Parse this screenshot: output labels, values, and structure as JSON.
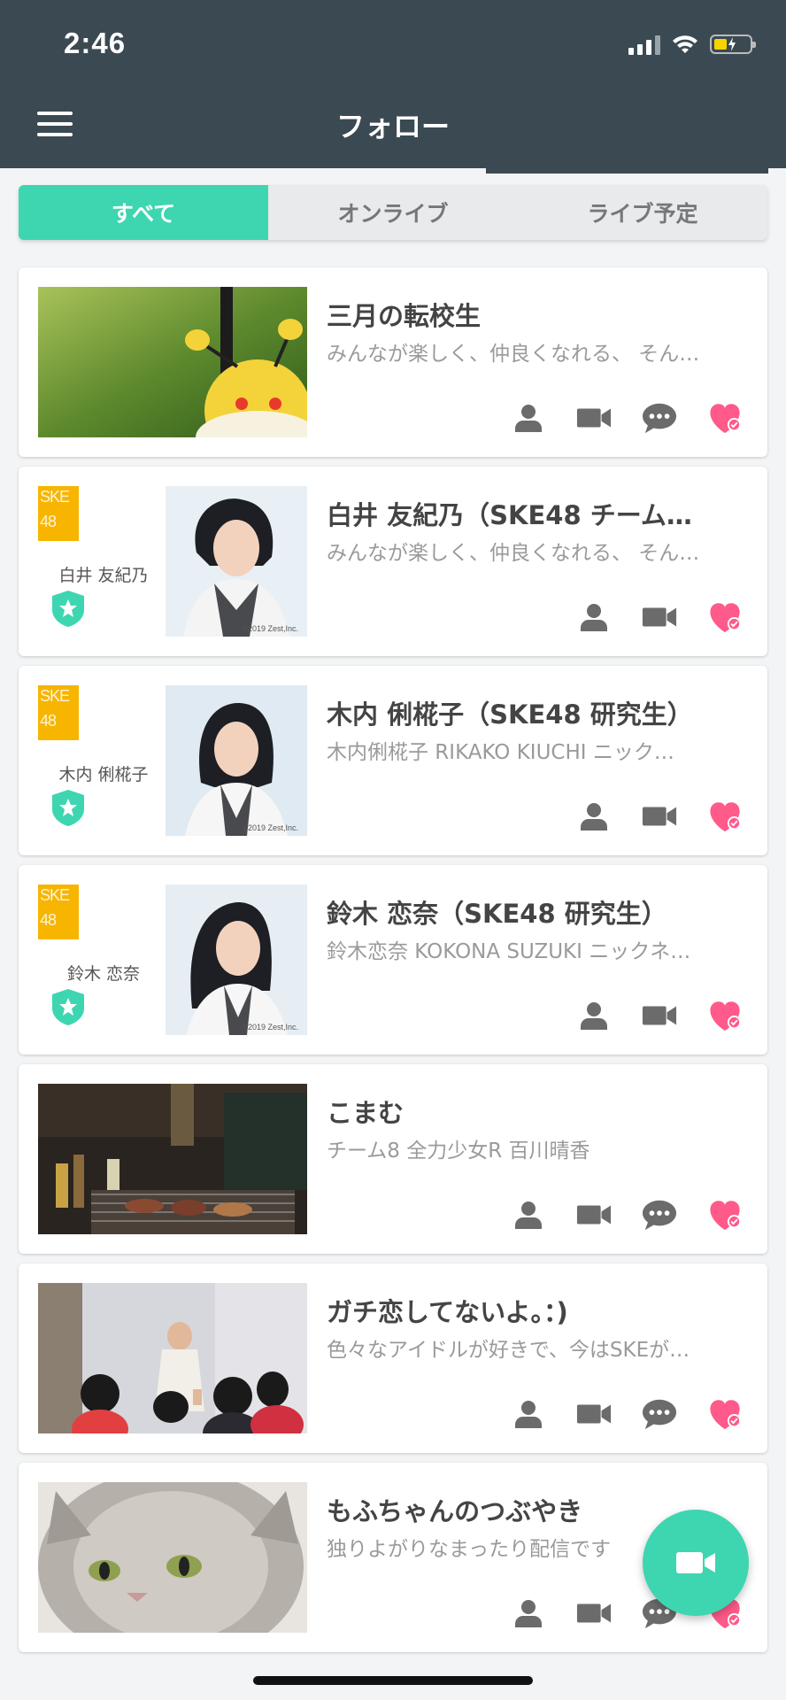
{
  "status_bar": {
    "time": "2:46"
  },
  "header": {
    "title": "フォロー",
    "menu_icon": "hamburger-menu-icon"
  },
  "tabs": [
    {
      "label": "すべて",
      "active": true
    },
    {
      "label": "オンライブ",
      "active": false
    },
    {
      "label": "ライブ予定",
      "active": false
    }
  ],
  "cards": [
    {
      "title": "三月の転校生",
      "description": "みんなが楽しく、仲良くなれる、 そん…",
      "actions": [
        "person-icon",
        "video-icon",
        "chat-icon",
        "heart-icon"
      ]
    },
    {
      "title": "白井 友紀乃（SKE48 チーム…",
      "description": "みんなが楽しく、仲良くなれる、 そん…",
      "member_name": "白井 友紀乃",
      "logo_text": "SKE48",
      "watermark": "©2019 Zest,Inc.",
      "actions": [
        "person-icon",
        "video-icon",
        "heart-icon"
      ]
    },
    {
      "title": "木内 俐椛子（SKE48 研究生）",
      "description": "木内俐椛子 RIKAKO KIUCHI ニック…",
      "member_name": "木内 俐椛子",
      "logo_text": "SKE48",
      "watermark": "©2019 Zest,Inc.",
      "actions": [
        "person-icon",
        "video-icon",
        "heart-icon"
      ]
    },
    {
      "title": "鈴木 恋奈（SKE48 研究生）",
      "description": "鈴木恋奈 KOKONA SUZUKI ニックネ…",
      "member_name": "鈴木 恋奈",
      "logo_text": "SKE48",
      "watermark": "©2019 Zest,Inc.",
      "actions": [
        "person-icon",
        "video-icon",
        "heart-icon"
      ]
    },
    {
      "title": "こまむ",
      "description": "チーム8 全力少女R 百川晴香",
      "actions": [
        "person-icon",
        "video-icon",
        "chat-icon",
        "heart-icon"
      ]
    },
    {
      "title": "ガチ恋してないよ。：)",
      "description": "色々なアイドルが好きで、今はSKEが…",
      "actions": [
        "person-icon",
        "video-icon",
        "chat-icon",
        "heart-icon"
      ]
    },
    {
      "title": "もふちゃんのつぶやき",
      "description": "独りよがりなまったり配信です",
      "actions": [
        "person-icon",
        "video-icon",
        "chat-icon",
        "heart-icon"
      ]
    }
  ],
  "colors": {
    "header": "#3b4a52",
    "accent": "#3dd6b0",
    "heart": "#ff5a8a",
    "icon": "#6b6b6b"
  }
}
